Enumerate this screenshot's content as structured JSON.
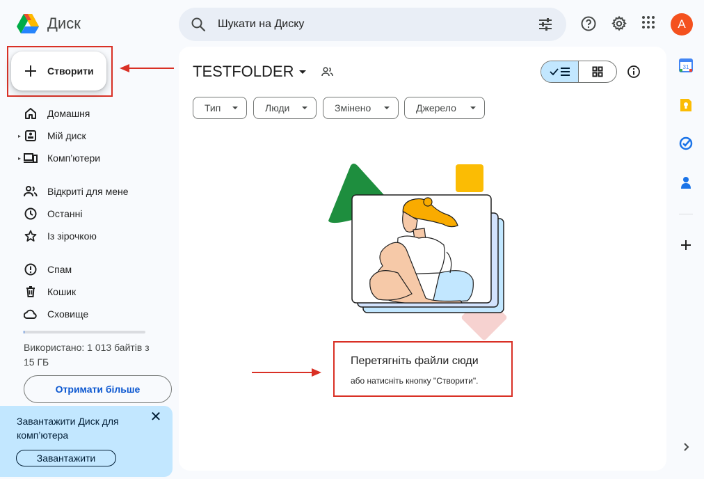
{
  "app": {
    "title": "Диск"
  },
  "search": {
    "placeholder": "Шукати на Диску"
  },
  "header": {
    "help_icon": "help-icon",
    "settings_icon": "gear-icon",
    "apps_icon": "apps-grid-icon",
    "avatar_letter": "A"
  },
  "sidebar": {
    "new_label": "Створити",
    "items": [
      {
        "label": "Домашня",
        "icon": "home-icon"
      },
      {
        "label": "Мій диск",
        "icon": "my-drive-icon"
      },
      {
        "label": "Комп’ютери",
        "icon": "computers-icon"
      },
      {
        "label": "Відкриті для мене",
        "icon": "shared-icon"
      },
      {
        "label": "Останні",
        "icon": "clock-icon"
      },
      {
        "label": "Із зірочкою",
        "icon": "star-icon"
      },
      {
        "label": "Спам",
        "icon": "spam-icon"
      },
      {
        "label": "Кошик",
        "icon": "trash-icon"
      },
      {
        "label": "Сховище",
        "icon": "cloud-icon"
      }
    ],
    "storage_text": "Використано: 1 013 байтів з 15 ГБ",
    "storage_used_fraction": 0.0,
    "get_more_label": "Отримати більше",
    "promo": {
      "text": "Завантажити Диск для комп’ютера",
      "button": "Завантажити"
    }
  },
  "main": {
    "folder_title": "TESTFOLDER",
    "filters": [
      "Тип",
      "Люди",
      "Змінено",
      "Джерело"
    ],
    "view_mode": "list",
    "empty_title": "Перетягніть файли сюди",
    "empty_subtitle": "або натисніть кнопку \"Створити\"."
  },
  "right_rail": {
    "calendar_day": "31",
    "apps": [
      "calendar-icon",
      "keep-icon",
      "tasks-icon",
      "contacts-icon"
    ]
  },
  "colors": {
    "accent": "#0b57d0",
    "annotation": "#d93025",
    "avatar": "#f4511e",
    "selected_bg": "#c2e7ff"
  }
}
